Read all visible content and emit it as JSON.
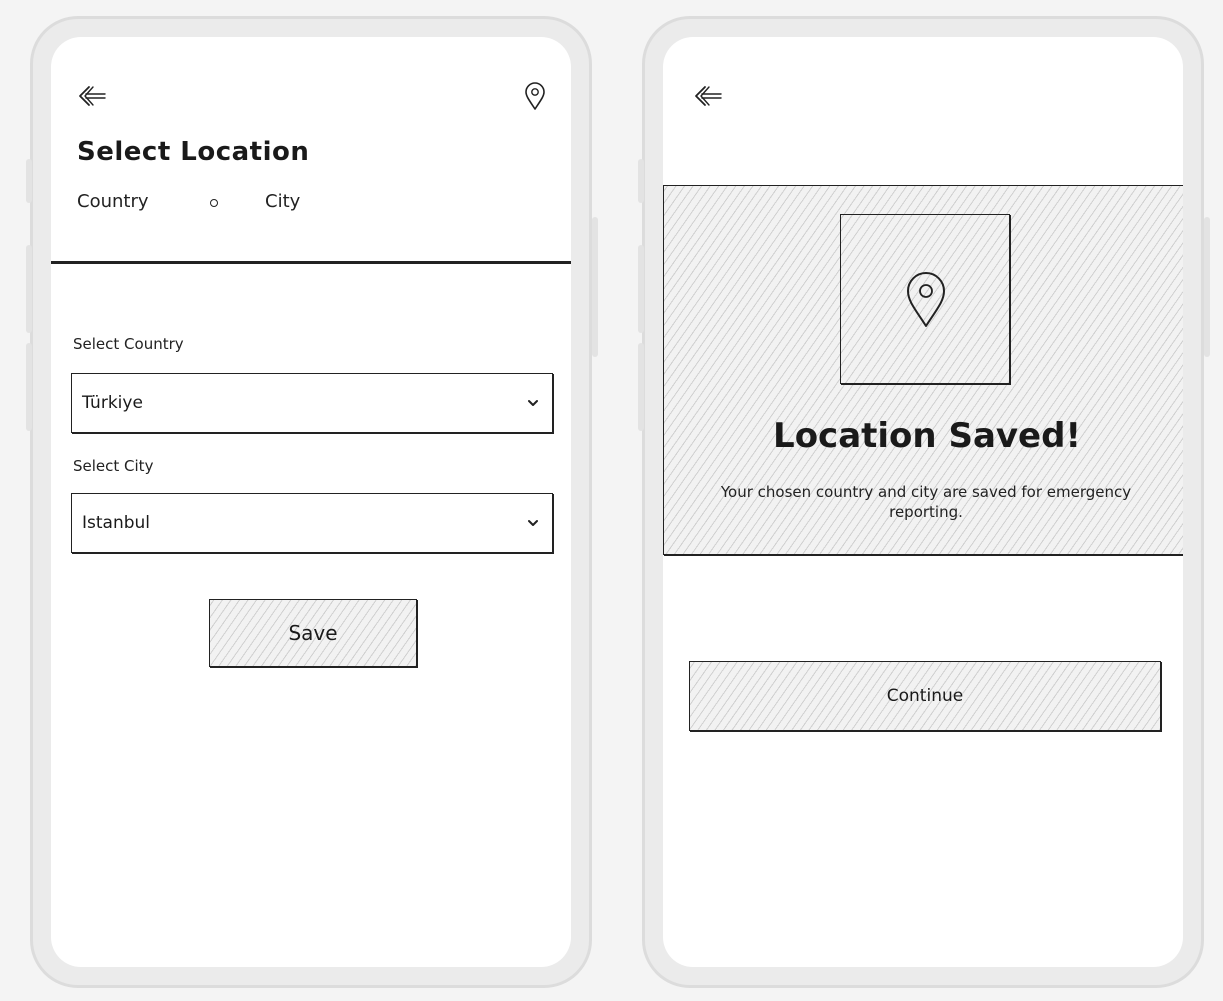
{
  "left_screen": {
    "header": {
      "back_icon": "back-arrow-icon",
      "location_icon": "location-pin-icon",
      "title": "Select Location"
    },
    "tabs": [
      {
        "label": "Country"
      },
      {
        "label": "City"
      }
    ],
    "form": {
      "country_label": "Select Country",
      "country_value": "Türkiye",
      "city_label": "Select City",
      "city_value": "Istanbul",
      "save_label": "Save"
    }
  },
  "right_screen": {
    "header": {
      "back_icon": "back-arrow-icon"
    },
    "confirmation": {
      "icon": "location-pin-icon",
      "title": "Location Saved!",
      "message": "Your chosen country and city are saved for emergency reporting."
    },
    "continue_label": "Continue"
  },
  "colors": {
    "background": "#f4f4f4",
    "device_frame": "#ebebeb",
    "screen": "#ffffff",
    "ink": "#1a1a1a",
    "hatch_fill": "#f2f2f2"
  }
}
